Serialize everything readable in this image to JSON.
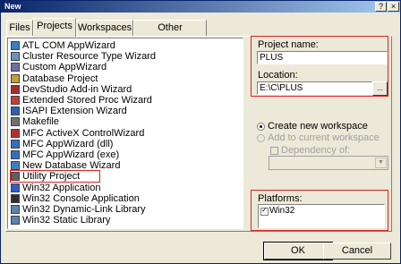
{
  "window": {
    "title": "New",
    "help_label": "?",
    "close_label": "×"
  },
  "tabs": [
    {
      "label": "Files"
    },
    {
      "label": "Projects"
    },
    {
      "label": "Workspaces"
    },
    {
      "label": "Other Documents"
    }
  ],
  "project_types": [
    {
      "label": "ATL COM AppWizard",
      "icon": "atl-icon",
      "color": "#3a7cc8"
    },
    {
      "label": "Cluster Resource Type Wizard",
      "icon": "cluster-icon",
      "color": "#6a8fc0"
    },
    {
      "label": "Custom AppWizard",
      "icon": "custom-wizard-icon",
      "color": "#7070a0"
    },
    {
      "label": "Database Project",
      "icon": "database-icon",
      "color": "#c8a030"
    },
    {
      "label": "DevStudio Add-in Wizard",
      "icon": "addin-icon",
      "color": "#a03030"
    },
    {
      "label": "Extended Stored Proc Wizard",
      "icon": "stored-proc-icon",
      "color": "#c04040"
    },
    {
      "label": "ISAPI Extension Wizard",
      "icon": "isapi-icon",
      "color": "#3060b0"
    },
    {
      "label": "Makefile",
      "icon": "makefile-icon",
      "color": "#707070"
    },
    {
      "label": "MFC ActiveX ControlWizard",
      "icon": "activex-icon",
      "color": "#b03030"
    },
    {
      "label": "MFC AppWizard (dll)",
      "icon": "mfc-dll-icon",
      "color": "#3070c0"
    },
    {
      "label": "MFC AppWizard (exe)",
      "icon": "mfc-exe-icon",
      "color": "#3070c0"
    },
    {
      "label": "New Database Wizard",
      "icon": "new-db-icon",
      "color": "#4080c0"
    },
    {
      "label": "Utility Project",
      "icon": "utility-icon",
      "color": "#606060"
    },
    {
      "label": "Win32 Application",
      "icon": "win32-app-icon",
      "color": "#3060c0"
    },
    {
      "label": "Win32 Console Application",
      "icon": "win32-console-icon",
      "color": "#303030"
    },
    {
      "label": "Win32 Dynamic-Link Library",
      "icon": "win32-dll-icon",
      "color": "#6080b0"
    },
    {
      "label": "Win32 Static Library",
      "icon": "win32-lib-icon",
      "color": "#6080b0"
    }
  ],
  "project_name": {
    "label": "Project name:",
    "value": "PLUS"
  },
  "location": {
    "label": "Location:",
    "value": "E:\\C\\PLUS",
    "browse_label": "..."
  },
  "workspace_options": {
    "create_label": "Create new workspace",
    "add_label": "Add to current workspace",
    "dependency_label": "Dependency of:",
    "selected": "create"
  },
  "platforms": {
    "label": "Platforms:",
    "items": [
      {
        "label": "Win32",
        "checked": true
      }
    ]
  },
  "buttons": {
    "ok_label": "OK",
    "cancel_label": "Cancel"
  },
  "colors": {
    "highlight_border": "#dd2222",
    "title_bar": "#0a246a"
  }
}
